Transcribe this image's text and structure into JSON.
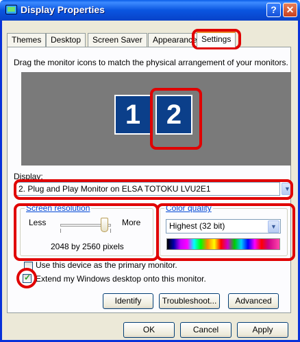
{
  "window": {
    "title": "Display Properties",
    "help_glyph": "?",
    "close_glyph": "✕"
  },
  "tabs": [
    {
      "label": "Themes"
    },
    {
      "label": "Desktop"
    },
    {
      "label": "Screen Saver"
    },
    {
      "label": "Appearance"
    },
    {
      "label": "Settings",
      "active": true
    }
  ],
  "settings": {
    "description": "Drag the monitor icons to match the physical arrangement of your monitors.",
    "monitors": [
      {
        "number": "1",
        "selected": false
      },
      {
        "number": "2",
        "selected": true
      }
    ],
    "display_label": "Display:",
    "display_value": "2. Plug and Play Monitor on ELSA TOTOKU LVU2E1",
    "screen_resolution": {
      "title": "Screen resolution",
      "less_label": "Less",
      "more_label": "More",
      "slider_level": 0.92,
      "value_text": "2048 by 2560 pixels"
    },
    "color_quality": {
      "title": "Color quality",
      "selected": "Highest (32 bit)"
    },
    "primary_checkbox": {
      "label": "Use this device as the primary monitor.",
      "checked": false
    },
    "extend_checkbox": {
      "label": "Extend my Windows desktop onto this monitor.",
      "checked": true
    },
    "buttons": {
      "identify": "Identify",
      "troubleshoot": "Troubleshoot...",
      "advanced": "Advanced"
    }
  },
  "footer": {
    "ok": "OK",
    "cancel": "Cancel",
    "apply": "Apply"
  },
  "colors": {
    "highlight": "#e00000",
    "titlebar": "#0a55e0",
    "monitor_fill": "#0b3f8a"
  }
}
